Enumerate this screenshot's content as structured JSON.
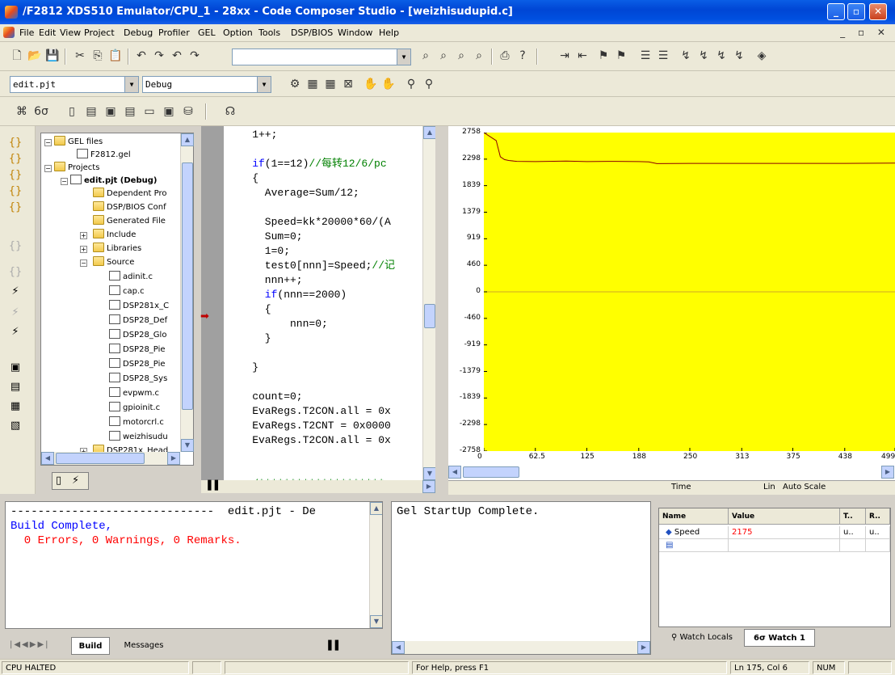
{
  "window": {
    "title": "/F2812 XDS510 Emulator/CPU_1 - 28xx - Code Composer Studio - [weizhisudupid.c]"
  },
  "menu": [
    "File",
    "Edit",
    "View",
    "Project",
    "Debug",
    "Profiler",
    "GEL",
    "Option",
    "Tools",
    "DSP/BIOS",
    "Window",
    "Help"
  ],
  "toolbar": {
    "project_combo": "edit.pjt",
    "config_combo": "Debug",
    "find_combo": ""
  },
  "project_tree": {
    "items": [
      "GEL files",
      "F2812.gel",
      "Projects",
      "edit.pjt (Debug)",
      "Dependent Pro",
      "DSP/BIOS Conf",
      "Generated File",
      "Include",
      "Libraries",
      "Source",
      "adinit.c",
      "cap.c",
      "DSP281x_C",
      "DSP28_Def",
      "DSP28_Glo",
      "DSP28_Pie",
      "DSP28_Pie",
      "DSP28_Sys",
      "evpwm.c",
      "gpioinit.c",
      "motorcrl.c",
      "weizhisudu",
      "DSP281x_Head"
    ]
  },
  "editor": {
    "lines": [
      {
        "text": "1++;",
        "indent": 4
      },
      {
        "text": "",
        "indent": 0
      },
      {
        "kw": "if",
        "text": "(1==12)",
        "cm": "//每转12/6/pc",
        "indent": 4
      },
      {
        "text": "{",
        "indent": 4
      },
      {
        "text": "Average=Sum/12;",
        "indent": 6
      },
      {
        "text": "",
        "indent": 0
      },
      {
        "text": "Speed=kk*20000*60/(A",
        "indent": 6
      },
      {
        "text": "Sum=0;",
        "indent": 6
      },
      {
        "text": "1=0;",
        "indent": 6
      },
      {
        "text": "test0[nnn]=Speed;",
        "cm": "//记",
        "indent": 6
      },
      {
        "text": "nnn++;",
        "indent": 6
      },
      {
        "kw": "if",
        "text": "(nnn==2000)",
        "indent": 6
      },
      {
        "text": "{",
        "indent": 6
      },
      {
        "text": "nnn=0;",
        "indent": 10
      },
      {
        "text": "}",
        "indent": 6
      },
      {
        "text": "",
        "indent": 0
      },
      {
        "text": "}",
        "indent": 4
      },
      {
        "text": "",
        "indent": 0
      },
      {
        "text": "count=0;",
        "indent": 4
      },
      {
        "text": "EvaRegs.T2CON.all = 0x",
        "indent": 4
      },
      {
        "text": "EvaRegs.T2CNT = 0x0000",
        "indent": 4
      },
      {
        "text": "EvaRegs.T2CON.all = 0x",
        "indent": 4
      },
      {
        "text": "",
        "indent": 0
      },
      {
        "text": "",
        "indent": 0
      },
      {
        "cm": "/********************",
        "text": "",
        "indent": 4
      }
    ]
  },
  "chart_data": {
    "type": "line",
    "x": [
      0,
      15,
      20,
      25,
      30,
      40,
      62.5,
      100,
      125,
      150,
      188,
      200,
      210,
      250,
      313,
      375,
      438,
      499
    ],
    "series": [
      {
        "values": [
          2758,
          2620,
          2340,
          2290,
          2275,
          2260,
          2255,
          2265,
          2255,
          2260,
          2255,
          2250,
          2220,
          2225,
          2225,
          2225,
          2225,
          2230
        ]
      }
    ],
    "xlabel": "Time",
    "yticks": [
      "2758",
      "2298",
      "1839",
      "1379",
      "919",
      "460",
      "0",
      "-460",
      "-919",
      "-1379",
      "-1839",
      "-2298",
      "-2758"
    ],
    "xticks": [
      "0",
      "62.5",
      "125",
      "188",
      "250",
      "313",
      "375",
      "438",
      "499"
    ],
    "ylim": [
      -2758,
      2758
    ],
    "xlim": [
      0,
      499
    ],
    "scale_mode": "Lin",
    "scale_label": "Auto Scale",
    "plot_bg": "#ffff00",
    "line_color": "#8b0000"
  },
  "build_output": {
    "header": "------------------------------  edit.pjt - De",
    "line1": "Build Complete,",
    "line2": "  0 Errors, 0 Warnings, 0 Remarks.",
    "tabs": [
      "Build",
      "Messages"
    ]
  },
  "gel_output": {
    "line1": "Gel StartUp Complete."
  },
  "watch": {
    "headers": [
      "Name",
      "Value",
      "T..",
      "R.."
    ],
    "rows": [
      {
        "name": "Speed",
        "value": "2175",
        "type": "u..",
        "radix": "u.."
      }
    ],
    "tabs": [
      "Watch Locals",
      "Watch 1"
    ]
  },
  "status": {
    "cpu": "CPU HALTED",
    "help": "For Help, press F1",
    "position": "Ln 175, Col 6",
    "num": "NUM"
  }
}
